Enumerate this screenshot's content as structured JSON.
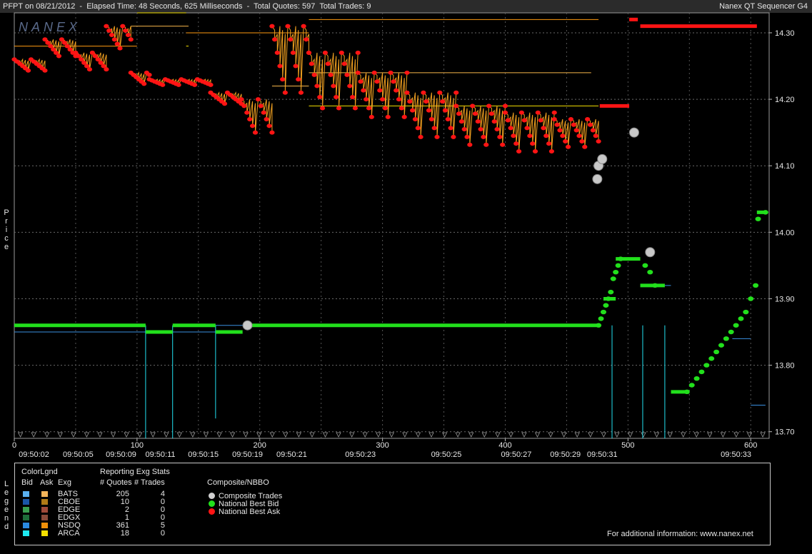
{
  "header": {
    "left": "PFPT on 08/21/2012  -  Elapsed Time: 48 Seconds, 625 Milliseconds  -  Total Quotes: 597  Total Trades: 9",
    "right": "Nanex QT Sequencer G4"
  },
  "watermark": "NANEX",
  "side_labels": {
    "price": "Price",
    "legend": "Legend"
  },
  "chart_data": {
    "type": "line",
    "ylim": [
      13.69,
      14.33
    ],
    "xlim": [
      0,
      615
    ],
    "y_ticks": [
      "14.30",
      "14.20",
      "14.10",
      "14.00",
      "13.90",
      "13.80",
      "13.70"
    ],
    "x_ticks": [
      {
        "v": 0,
        "label": "0"
      },
      {
        "v": 100,
        "label": "100"
      },
      {
        "v": 200,
        "label": "200"
      },
      {
        "v": 300,
        "label": "300"
      },
      {
        "v": 400,
        "label": "400"
      },
      {
        "v": 500,
        "label": "500"
      },
      {
        "v": 600,
        "label": "600"
      }
    ],
    "time_labels": [
      {
        "v": 16,
        "label": "09:50:02"
      },
      {
        "v": 52,
        "label": "09:50:05"
      },
      {
        "v": 87,
        "label": "09:50:09"
      },
      {
        "v": 119,
        "label": "09:50:11"
      },
      {
        "v": 154,
        "label": "09:50:15"
      },
      {
        "v": 190,
        "label": "09:50:19"
      },
      {
        "v": 226,
        "label": "09:50:21"
      },
      {
        "v": 282,
        "label": "09:50:23"
      },
      {
        "v": 352,
        "label": "09:50:25"
      },
      {
        "v": 409,
        "label": "09:50:27"
      },
      {
        "v": 449,
        "label": "09:50:29"
      },
      {
        "v": 479,
        "label": "09:50:31"
      },
      {
        "v": 588,
        "label": "09:50:33"
      }
    ],
    "series": [
      {
        "name": "National Best Bid",
        "color": "#22e01c",
        "segments": [
          [
            0,
            107,
            13.86
          ],
          [
            107,
            129,
            13.85
          ],
          [
            129,
            164,
            13.86
          ],
          [
            164,
            186,
            13.85
          ],
          [
            191,
            476,
            13.86
          ],
          [
            480,
            490,
            13.9
          ],
          [
            490,
            510,
            13.96
          ],
          [
            510,
            530,
            13.92
          ],
          [
            535,
            550,
            13.76
          ],
          [
            605,
            612,
            14.03
          ]
        ],
        "steps": [
          [
            476,
            13.86
          ],
          [
            478,
            13.87
          ],
          [
            480,
            13.88
          ],
          [
            482,
            13.89
          ],
          [
            484,
            13.9
          ],
          [
            486,
            13.91
          ],
          [
            488,
            13.93
          ],
          [
            490,
            13.94
          ],
          [
            492,
            13.95
          ],
          [
            494,
            13.96
          ],
          [
            514,
            13.95
          ],
          [
            518,
            13.94
          ],
          [
            522,
            13.92
          ],
          [
            548,
            13.76
          ],
          [
            552,
            13.77
          ],
          [
            556,
            13.78
          ],
          [
            560,
            13.79
          ],
          [
            564,
            13.8
          ],
          [
            568,
            13.81
          ],
          [
            572,
            13.82
          ],
          [
            576,
            13.83
          ],
          [
            580,
            13.84
          ],
          [
            584,
            13.85
          ],
          [
            588,
            13.86
          ],
          [
            592,
            13.87
          ],
          [
            596,
            13.88
          ],
          [
            600,
            13.9
          ],
          [
            604,
            13.92
          ],
          [
            606,
            14.02
          ],
          [
            612,
            14.03
          ]
        ]
      },
      {
        "name": "National Best Ask",
        "color": "#ff1414",
        "segments": [
          [
            477,
            501,
            14.19
          ],
          [
            501,
            508,
            14.32
          ],
          [
            510,
            605,
            14.31
          ]
        ],
        "sawtooth": [
          [
            0,
            25,
            14.24,
            14.26
          ],
          [
            25,
            50,
            14.26,
            14.29
          ],
          [
            50,
            75,
            14.24,
            14.27
          ],
          [
            75,
            95,
            14.27,
            14.31
          ],
          [
            95,
            110,
            14.22,
            14.24
          ],
          [
            110,
            160,
            14.22,
            14.23
          ],
          [
            160,
            185,
            14.19,
            14.21
          ],
          [
            185,
            210,
            14.14,
            14.2
          ],
          [
            210,
            240,
            14.19,
            14.31
          ],
          [
            240,
            280,
            14.17,
            14.27
          ],
          [
            280,
            320,
            14.16,
            14.24
          ],
          [
            320,
            360,
            14.13,
            14.21
          ],
          [
            360,
            400,
            14.12,
            14.19
          ],
          [
            400,
            440,
            14.11,
            14.18
          ],
          [
            440,
            476,
            14.12,
            14.17
          ]
        ]
      },
      {
        "name": "Composite Trades",
        "color": "#c8c8c8",
        "points": [
          [
            190,
            13.86
          ],
          [
            475,
            14.08
          ],
          [
            476,
            14.1
          ],
          [
            479,
            14.11
          ],
          [
            505,
            14.15
          ],
          [
            518,
            13.97
          ]
        ]
      }
    ],
    "exchange_lines": [
      {
        "exg": "BATS",
        "color": "#f5b54a",
        "segments": [
          [
            95,
            142,
            14.31
          ],
          [
            210,
            240,
            14.22
          ],
          [
            240,
            470,
            14.24
          ]
        ]
      },
      {
        "exg": "NSDQ",
        "color": "#ff9a10",
        "segments": [
          [
            0,
            100,
            14.28
          ],
          [
            140,
            240,
            14.3
          ],
          [
            240,
            476,
            14.32
          ]
        ]
      },
      {
        "exg": "ARCA",
        "color": "#f5e000",
        "segments": [
          [
            100,
            140,
            14.33
          ],
          [
            140,
            142,
            14.28
          ],
          [
            240,
            330,
            14.19
          ],
          [
            330,
            476,
            14.19
          ]
        ]
      },
      {
        "exg": "NSDQ-bid",
        "color": "#3a8fe0",
        "segments": [
          [
            0,
            107,
            13.85
          ],
          [
            107,
            164,
            13.85
          ],
          [
            164,
            476,
            13.86
          ],
          [
            520,
            535,
            13.92
          ],
          [
            585,
            600,
            13.84
          ],
          [
            600,
            612,
            13.74
          ]
        ]
      },
      {
        "exg": "ARCA-bid",
        "color": "#22e0f0",
        "segments": [
          [
            107,
            108,
            13.69
          ],
          [
            129,
            130,
            13.69
          ],
          [
            164,
            165,
            13.72
          ],
          [
            487,
            488,
            13.69
          ],
          [
            512,
            513,
            13.69
          ],
          [
            530,
            531,
            13.69
          ]
        ]
      }
    ]
  },
  "legend": {
    "color_legend_title": "ColorLgnd",
    "stats_title": "Reporting Exg Stats",
    "col_bid": "Bid",
    "col_ask": "Ask",
    "col_exg": "Exg",
    "col_quotes": "# Quotes",
    "col_trades": "# Trades",
    "exchanges": [
      {
        "exg": "BATS",
        "quotes": "205",
        "trades": "4",
        "bid_color": "#5ab0f0",
        "ask_color": "#f5b55a"
      },
      {
        "exg": "CBOE",
        "quotes": "10",
        "trades": "0",
        "bid_color": "#1a56a8",
        "ask_color": "#b07a16"
      },
      {
        "exg": "EDGE",
        "quotes": "2",
        "trades": "0",
        "bid_color": "#3aa050",
        "ask_color": "#a04a3a"
      },
      {
        "exg": "EDGX",
        "quotes": "1",
        "trades": "0",
        "bid_color": "#1e6e3a",
        "ask_color": "#8a4a3a"
      },
      {
        "exg": "NSDQ",
        "quotes": "361",
        "trades": "5",
        "bid_color": "#2a8ae0",
        "ask_color": "#f0900a"
      },
      {
        "exg": "ARCA",
        "quotes": "18",
        "trades": "0",
        "bid_color": "#1ee8f0",
        "ask_color": "#f5e000"
      }
    ],
    "composite_title": "Composite/NBBO",
    "composite_items": [
      {
        "label": "Composite Trades",
        "color": "#d0d0d0"
      },
      {
        "label": "National Best Bid",
        "color": "#22e01c"
      },
      {
        "label": "National Best Ask",
        "color": "#ff1414"
      }
    ],
    "footer": "For additional information: www.nanex.net"
  }
}
